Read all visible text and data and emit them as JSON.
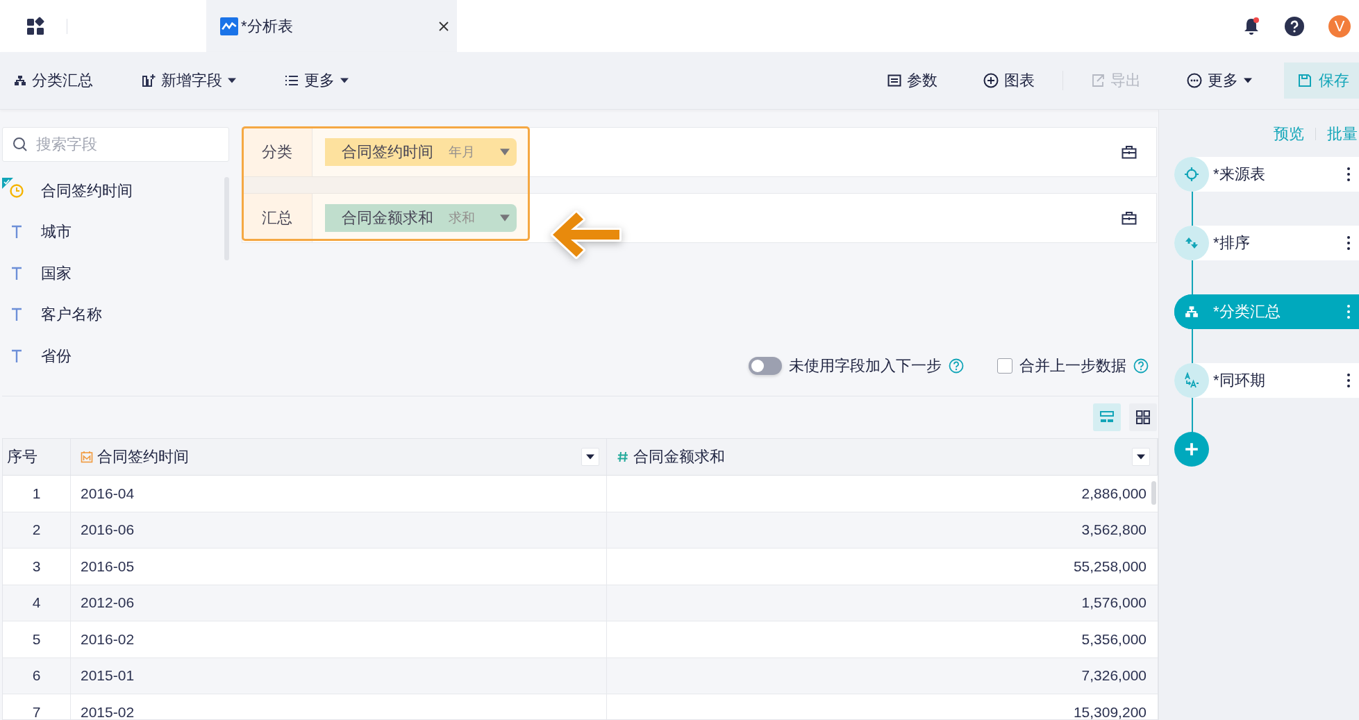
{
  "app_bar": {
    "tab": {
      "title": "*分析表",
      "selected": true
    },
    "avatar": "V"
  },
  "toolbar": {
    "left": [
      {
        "label": "分类汇总"
      },
      {
        "label": "新增字段"
      },
      {
        "label": "更多"
      }
    ],
    "right": [
      {
        "label": "参数",
        "disabled": false
      },
      {
        "label": "图表",
        "disabled": false
      },
      {
        "label": "导出",
        "disabled": true
      },
      {
        "label": "更多",
        "disabled": false
      }
    ],
    "save": "保存"
  },
  "field_panel": {
    "search": {
      "placeholder": "搜索字段"
    },
    "fields": [
      {
        "name": "合同签约时间",
        "kind": "date",
        "checked": true
      },
      {
        "name": "城市",
        "kind": "text",
        "checked": false
      },
      {
        "name": "国家",
        "kind": "text",
        "checked": false
      },
      {
        "name": "客户名称",
        "kind": "text",
        "checked": false
      },
      {
        "name": "省份",
        "kind": "text",
        "checked": false
      }
    ]
  },
  "config": {
    "rows": [
      {
        "label": "分类",
        "field": "合同签约时间",
        "aggregation": "年月",
        "color": "#fde29a"
      },
      {
        "label": "汇总",
        "field": "合同金额求和",
        "aggregation": "求和",
        "color": "#b3dfd4"
      }
    ],
    "toggle": {
      "label": "未使用字段加入下一步",
      "on": false
    },
    "checkbox": {
      "label": "合并上一步数据",
      "checked": false
    }
  },
  "view_modes": [
    {
      "selected": true
    },
    {
      "selected": false
    }
  ],
  "table": {
    "columns": [
      {
        "label": "序号",
        "kind": "index"
      },
      {
        "label": "合同签约时间",
        "kind": "date"
      },
      {
        "label": "合同金额求和",
        "kind": "number"
      }
    ],
    "rows": [
      [
        "1",
        "2016-04",
        "2,886,000"
      ],
      [
        "2",
        "2016-06",
        "3,562,800"
      ],
      [
        "3",
        "2016-05",
        "55,258,000"
      ],
      [
        "4",
        "2012-06",
        "1,576,000"
      ],
      [
        "5",
        "2016-02",
        "5,356,000"
      ],
      [
        "6",
        "2015-01",
        "7,326,000"
      ],
      [
        "7",
        "2015-02",
        "15,309,200"
      ]
    ]
  },
  "steps_panel": {
    "links": [
      "预览",
      "批量"
    ],
    "steps": [
      {
        "label": "*来源表",
        "selected": false
      },
      {
        "label": "*排序",
        "selected": false
      },
      {
        "label": "*分类汇总",
        "selected": true
      },
      {
        "label": "*同环期",
        "selected": false
      }
    ]
  }
}
